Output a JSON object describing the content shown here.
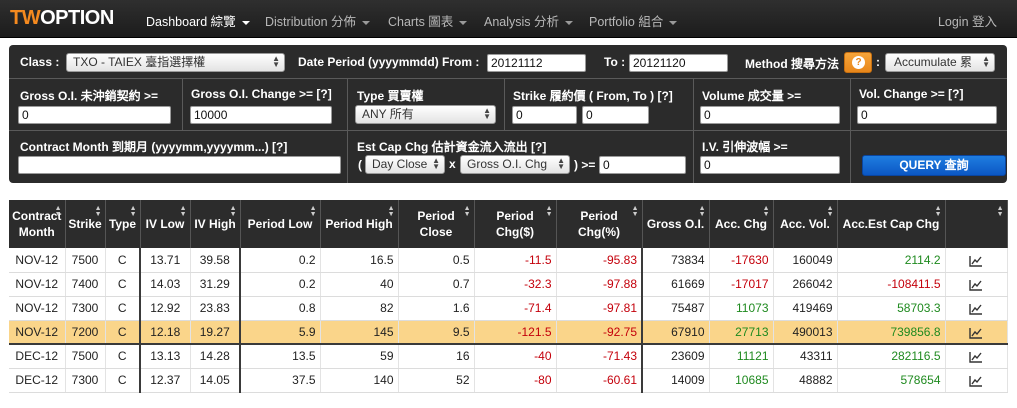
{
  "brand": {
    "part1": "TW",
    "part2": "OPTION"
  },
  "nav": {
    "items": [
      {
        "label": "Dashboard 綜覽"
      },
      {
        "label": "Distribution 分佈"
      },
      {
        "label": "Charts 圖表"
      },
      {
        "label": "Analysis 分析"
      },
      {
        "label": "Portfolio 組合"
      }
    ],
    "login": "Login 登入"
  },
  "filters": {
    "class_label": "Class :",
    "class_value": "TXO - TAIEX 臺指選擇權",
    "date_from_label": "Date Period (yyyymmdd) From :",
    "date_from": "20121112",
    "date_to_label": "To :",
    "date_to": "20121120",
    "method_label": "Method 搜尋方法",
    "method_colon": ":",
    "method_value": "Accumulate 累",
    "gross_oi_label": "Gross O.I. 未沖銷契約 >=",
    "gross_oi_value": "0",
    "gross_oi_change_label": "Gross O.I. Change >= [?]",
    "gross_oi_change_value": "10000",
    "type_label": "Type 買賣權",
    "type_value": "ANY 所有",
    "strike_label": "Strike 履約價 ( From, To ) [?]",
    "strike_from": "0",
    "strike_to": "0",
    "volume_label": "Volume 成交量 >=",
    "volume_value": "0",
    "vol_change_label": "Vol. Change >= [?]",
    "vol_change_value": "0",
    "contract_month_label": "Contract Month 到期月 (yyyymm,yyyymm...) [?]",
    "contract_month_value": "",
    "est_cap_label": "Est Cap Chg 估計資金流入流出 [?]",
    "est_paren_open": "(",
    "est_sel1": "Day Close",
    "est_mult": "x",
    "est_sel2": "Gross O.I. Chg",
    "est_paren_close": ") >=",
    "est_value": "0",
    "iv_label": "I.V. 引伸波幅 >=",
    "iv_value": "0",
    "query_label": "QUERY 查詢"
  },
  "table": {
    "headers": [
      "Contract Month",
      "Strike",
      "Type",
      "IV Low",
      "IV High",
      "Period Low",
      "Period High",
      "Period Close",
      "Period Chg($)",
      "Period Chg(%)",
      "Gross O.I.",
      "Acc. Chg",
      "Acc. Vol.",
      "Acc.Est Cap Chg",
      ""
    ],
    "rows": [
      [
        "NOV-12",
        "7500",
        "C",
        "13.71",
        "39.58",
        "0.2",
        "16.5",
        "0.5",
        "-11.5",
        "-95.83",
        "73834",
        "-17630",
        "160049",
        "2114.2"
      ],
      [
        "NOV-12",
        "7400",
        "C",
        "14.03",
        "31.29",
        "0.2",
        "40",
        "0.7",
        "-32.3",
        "-97.88",
        "61669",
        "-17017",
        "266042",
        "-108411.5"
      ],
      [
        "NOV-12",
        "7300",
        "C",
        "12.92",
        "23.83",
        "0.8",
        "82",
        "1.6",
        "-71.4",
        "-97.81",
        "75487",
        "11073",
        "419469",
        "58703.3"
      ],
      [
        "NOV-12",
        "7200",
        "C",
        "12.18",
        "19.27",
        "5.9",
        "145",
        "9.5",
        "-121.5",
        "-92.75",
        "67910",
        "27713",
        "490013",
        "739856.8"
      ],
      [
        "DEC-12",
        "7500",
        "C",
        "13.13",
        "14.28",
        "13.5",
        "59",
        "16",
        "-40",
        "-71.43",
        "23609",
        "11121",
        "43311",
        "282116.5"
      ],
      [
        "DEC-12",
        "7300",
        "C",
        "12.37",
        "14.05",
        "37.5",
        "140",
        "52",
        "-80",
        "-60.61",
        "14009",
        "10685",
        "48882",
        "578654"
      ]
    ]
  },
  "colors": {
    "brand_orange": "#f58a1f",
    "negative": "#c4000b",
    "positive": "#1f8a1f",
    "highlight_row": "#fad58a",
    "query_blue": "#0b57c4"
  }
}
